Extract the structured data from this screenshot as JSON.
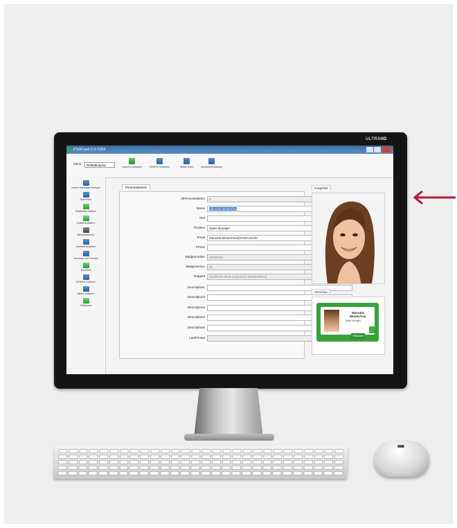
{
  "window": {
    "title": "PSDCard 2.0.7264",
    "monitor_brand_a": "ULTRA",
    "monitor_brand_b": "HD"
  },
  "toolbar": {
    "menu_label": "Menü",
    "layout_value": "DefaultLayout",
    "buttons": [
      {
        "label": "Layouts anpassen"
      },
      {
        "label": "DESFire auslesen"
      },
      {
        "label": "Mifare lesen"
      },
      {
        "label": "Ausweisverwaltung"
      }
    ]
  },
  "sidebar": {
    "items": [
      {
        "label": "Neuen Datensatz anlegen"
      },
      {
        "label": "Speichern"
      },
      {
        "label": "Rückwärts blättern"
      },
      {
        "label": "Vorwärts blättern"
      },
      {
        "label": "Bild aufnehmen"
      },
      {
        "label": "Ausweis erstellen"
      },
      {
        "label": "Vorschau und Drucker"
      },
      {
        "label": "Erweitert"
      },
      {
        "label": "DESFire codieren"
      },
      {
        "label": "Mifare codieren"
      },
      {
        "label": "Schliessen"
      }
    ]
  },
  "form": {
    "tab_label": "Personalstamm",
    "fields": [
      {
        "label": "idPersonalstamm",
        "value": "5",
        "readonly": true
      },
      {
        "label": "Name",
        "value": "Manuela Musterfrau",
        "selected": true,
        "required": true
      },
      {
        "label": "Titel",
        "value": ""
      },
      {
        "label": "Position",
        "value": "Sales Manager",
        "required": true
      },
      {
        "label": "Email",
        "value": "Manuela.Musterfrau@PSDCard.de",
        "required": true
      },
      {
        "label": "Phone",
        "value": ""
      },
      {
        "label": "Badgenumber",
        "value": "00000000",
        "readonly": true
      },
      {
        "label": "Badgeversion",
        "value": "00",
        "readonly": true
      },
      {
        "label": "ImageId",
        "value": "{a25f8c92-2b49-44a8-bc81-8f6b5f29f5c3}",
        "readonly": true
      },
      {
        "label": "Description1",
        "value": ""
      },
      {
        "label": "Description2",
        "value": ""
      },
      {
        "label": "Description3",
        "value": ""
      },
      {
        "label": "Description4",
        "value": ""
      },
      {
        "label": "Description5",
        "value": ""
      },
      {
        "label": "LastPrinted",
        "value": "",
        "readonly": true
      }
    ]
  },
  "image_panel": {
    "title": "Imagebild"
  },
  "preview_panel": {
    "title": "Vorschau",
    "card_name": "Manuela Musterfrau",
    "card_position": "Sales Manager",
    "card_logo": "PSDCard"
  },
  "colors": {
    "accent_green": "#3aa13a",
    "arrow": "#b01c3c",
    "titlebar": "#3b6ea2"
  }
}
